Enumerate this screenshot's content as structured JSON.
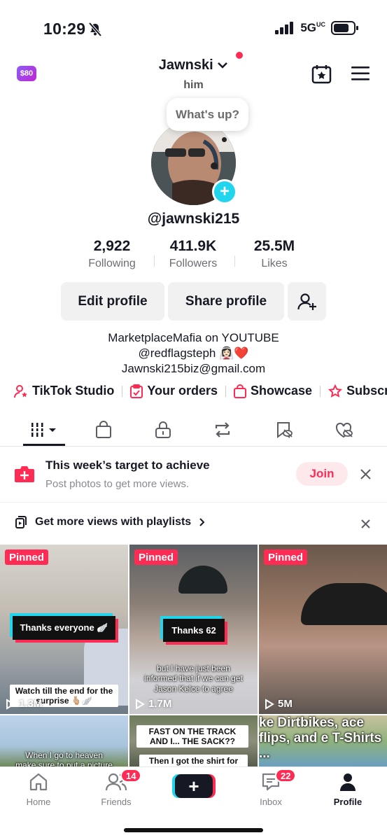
{
  "status_bar": {
    "time": "10:29",
    "network": "5G",
    "network_suffix": "UC"
  },
  "header": {
    "coins": "$80",
    "username": "Jawnski",
    "pronouns": "him"
  },
  "note_bubble": "What's up?",
  "profile": {
    "handle": "@jawnski215",
    "stats": [
      {
        "value": "2,922",
        "label": "Following"
      },
      {
        "value": "411.9K",
        "label": "Followers"
      },
      {
        "value": "25.5M",
        "label": "Likes"
      }
    ],
    "buttons": {
      "edit": "Edit profile",
      "share": "Share profile"
    },
    "bio": [
      "MarketplaceMafia on YOUTUBE",
      "@redflagsteph 👰🏻‍♀️❤️",
      "Jawnski215biz@gmail.com"
    ]
  },
  "links": [
    "TikTok Studio",
    "Your orders",
    "Showcase",
    "Subscrip"
  ],
  "tabs": [
    "videos-grid",
    "shop",
    "private",
    "reposts",
    "favorites",
    "liked"
  ],
  "target_card": {
    "title": "This week’s target to achieve",
    "subtitle": "Post photos to get more views.",
    "join": "Join"
  },
  "playlist_banner": "Get more views with playlists",
  "videos": [
    {
      "pinned": "Pinned",
      "caption": "Thanks everyone 🪽",
      "bottom_caption": "Watch till the end for the surprise 🫰🏼🪽",
      "views": "1.3M"
    },
    {
      "pinned": "Pinned",
      "caption": "Thanks 62",
      "overlay": "but I have just been informed that if we can get Jason Kelce to agree",
      "views": "1.7M"
    },
    {
      "pinned": "Pinned",
      "views": "5M"
    },
    {
      "overlay": "When I go to heaven make sure to put a picture"
    },
    {
      "top_caption": "FAST ON THE TRACK AND I... THE SACK??",
      "bottom_caption": "Then I got the shirt for YOU!"
    },
    {
      "overlay": "ke Dirtbikes, ace flips, and e T-Shirts ..."
    }
  ],
  "bottom_nav": {
    "home": "Home",
    "friends": "Friends",
    "friends_badge": "14",
    "inbox": "Inbox",
    "inbox_badge": "22",
    "profile": "Profile"
  }
}
